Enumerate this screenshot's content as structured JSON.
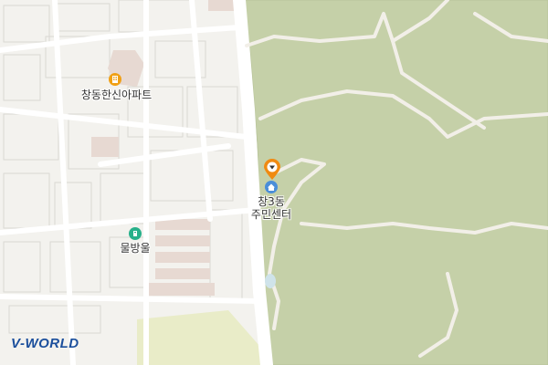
{
  "map": {
    "colors": {
      "urban": "#f3f2ee",
      "block_outline": "#d9d8d3",
      "road": "#ffffff",
      "road_edge": "#dedcd6",
      "park": "#c5d0a8",
      "park_edge": "#b9c59b",
      "trail": "#f2efe8",
      "water": "#cfe3ea",
      "building_pink": "#e7d9d2",
      "sports_yellow": "#e9ecc8",
      "poi_orange": "#f0a015",
      "poi_blue": "#4a8ed8",
      "poi_green": "#27b08a",
      "marker_orange": "#f08a11"
    },
    "pois": [
      {
        "id": "apartment",
        "label": "창동한신아파트",
        "icon": "apartment-icon"
      },
      {
        "id": "community_center",
        "label": "창3동\n주민센터",
        "icon": "community-center-icon"
      },
      {
        "id": "water_spot",
        "label": "물방울",
        "icon": "fountain-icon"
      }
    ],
    "marker": {
      "icon": "location-pin-icon"
    },
    "logo": {
      "text_v": "V",
      "text_rest": "-WORLD"
    }
  }
}
